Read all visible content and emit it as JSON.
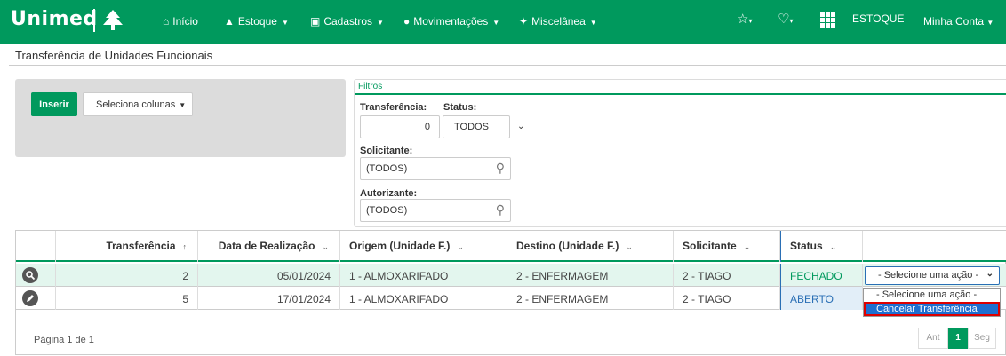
{
  "brand": {
    "name": "Unimed",
    "logo_icon": "unimed-tree-icon"
  },
  "nav": {
    "items": [
      {
        "label": "Início",
        "icon": "home-icon"
      },
      {
        "label": "Estoque",
        "icon": "boxes-icon"
      },
      {
        "label": "Cadastros",
        "icon": "cabinet-icon"
      },
      {
        "label": "Movimentações",
        "icon": "users-icon"
      },
      {
        "label": "Miscelânea",
        "icon": "magic-icon"
      }
    ],
    "module": "ESTOQUE",
    "account": "Minha Conta"
  },
  "page": {
    "title": "Transferência de Unidades Funcionais"
  },
  "actions": {
    "insert": "Inserir",
    "columns": "Seleciona colunas"
  },
  "filters": {
    "legend": "Filtros",
    "transferencia_label": "Transferência:",
    "transferencia_value": "0",
    "status_label": "Status:",
    "status_value": "TODOS",
    "solicitante_label": "Solicitante:",
    "solicitante_value": "(TODOS)",
    "autorizante_label": "Autorizante:",
    "autorizante_value": "(TODOS)"
  },
  "table": {
    "headers": [
      "Transferência",
      "Data de Realização",
      "Origem (Unidade F.)",
      "Destino (Unidade F.)",
      "Solicitante",
      "Status"
    ],
    "rows": [
      {
        "transferencia": "2",
        "data": "05/01/2024",
        "origem": "1 - ALMOXARIFADO",
        "destino": "2 - ENFERMAGEM",
        "solicitante": "2 - TIAGO",
        "status": "FECHADO",
        "icon": "search-icon"
      },
      {
        "transferencia": "5",
        "data": "17/01/2024",
        "origem": "1 - ALMOXARIFADO",
        "destino": "2 - ENFERMAGEM",
        "solicitante": "2 - TIAGO",
        "status": "ABERTO",
        "icon": "pencil-icon"
      }
    ],
    "action_select": "- Selecione uma ação -",
    "action_options": [
      "- Selecione uma ação -",
      "Cancelar Transferência"
    ]
  },
  "pagination": {
    "info": "Página 1 de 1",
    "prev": "Ant",
    "current": "1",
    "next": "Seg"
  },
  "colors": {
    "primary": "#00995d",
    "selected": "#1e6fd0",
    "highlight_border": "#dd0000"
  }
}
